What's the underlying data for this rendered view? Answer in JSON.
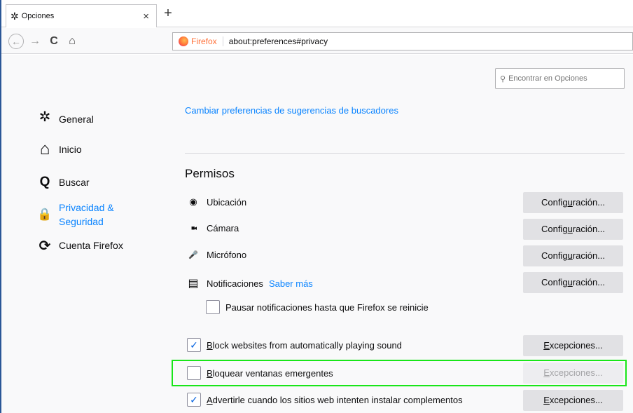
{
  "tab": {
    "title": "Opciones",
    "icon": "gear-icon",
    "close_glyph": "×"
  },
  "new_tab_glyph": "+",
  "navbar": {
    "back_glyph": "←",
    "forward_glyph": "→",
    "reload_glyph": "C",
    "home_glyph": "⌂",
    "identity_label": "Firefox",
    "url": "about:preferences#privacy"
  },
  "search": {
    "placeholder": "Encontrar en Opciones",
    "glyph": "⚲"
  },
  "sidebar": {
    "items": [
      {
        "label": "General",
        "icon": "gear-icon",
        "glyph": "✲"
      },
      {
        "label": "Inicio",
        "icon": "home-icon",
        "glyph": "⌂"
      },
      {
        "label": "Buscar",
        "icon": "search-icon",
        "glyph": "Q"
      },
      {
        "label_line1": "Privacidad &",
        "label_line2": "Seguridad",
        "icon": "lock-icon",
        "glyph": "🔒",
        "selected": true
      },
      {
        "label": "Cuenta Firefox",
        "icon": "sync-icon",
        "glyph": "⟳"
      }
    ]
  },
  "main": {
    "search_suggestions_link": "Cambiar preferencias de sugerencias de buscadores",
    "permissions_title": "Permisos",
    "permissions": [
      {
        "label": "Ubicación",
        "icon": "location-icon",
        "glyph": "◉",
        "button_pre": "Config",
        "button_u": "u",
        "button_post": "ración..."
      },
      {
        "label": "Cámara",
        "icon": "camera-icon",
        "glyph": "■◂",
        "button_pre": "Config",
        "button_u": "u",
        "button_post": "ración..."
      },
      {
        "label": "Micrófono",
        "icon": "microphone-icon",
        "glyph": "🎤",
        "button_pre": "Config",
        "button_u": "u",
        "button_post": "ración..."
      },
      {
        "label": "Notificaciones",
        "icon": "notification-icon",
        "glyph": "▤",
        "link": "Saber más",
        "button_pre": "Config",
        "button_u": "u",
        "button_post": "ración..."
      }
    ],
    "pause_notifications": {
      "label": "Pausar notificaciones hasta que Firefox se reinicie",
      "checked": false
    },
    "block_sound": {
      "label_u": "B",
      "label_rest": "lock websites from automatically playing sound",
      "checked": true,
      "button_pre": "",
      "button_u": "E",
      "button_post": "xcepciones..."
    },
    "block_popups": {
      "label_u": "B",
      "label_rest": "loquear ventanas emergentes",
      "checked": false,
      "button_pre": "",
      "button_u": "E",
      "button_post": "xcepciones...",
      "button_disabled": true
    },
    "warn_addons": {
      "label_u": "A",
      "label_rest": "dvertirle cuando los sitios web intenten instalar complementos",
      "checked": true,
      "button_pre": "",
      "button_u": "E",
      "button_post": "xcepciones..."
    }
  },
  "check_glyph": "✓"
}
